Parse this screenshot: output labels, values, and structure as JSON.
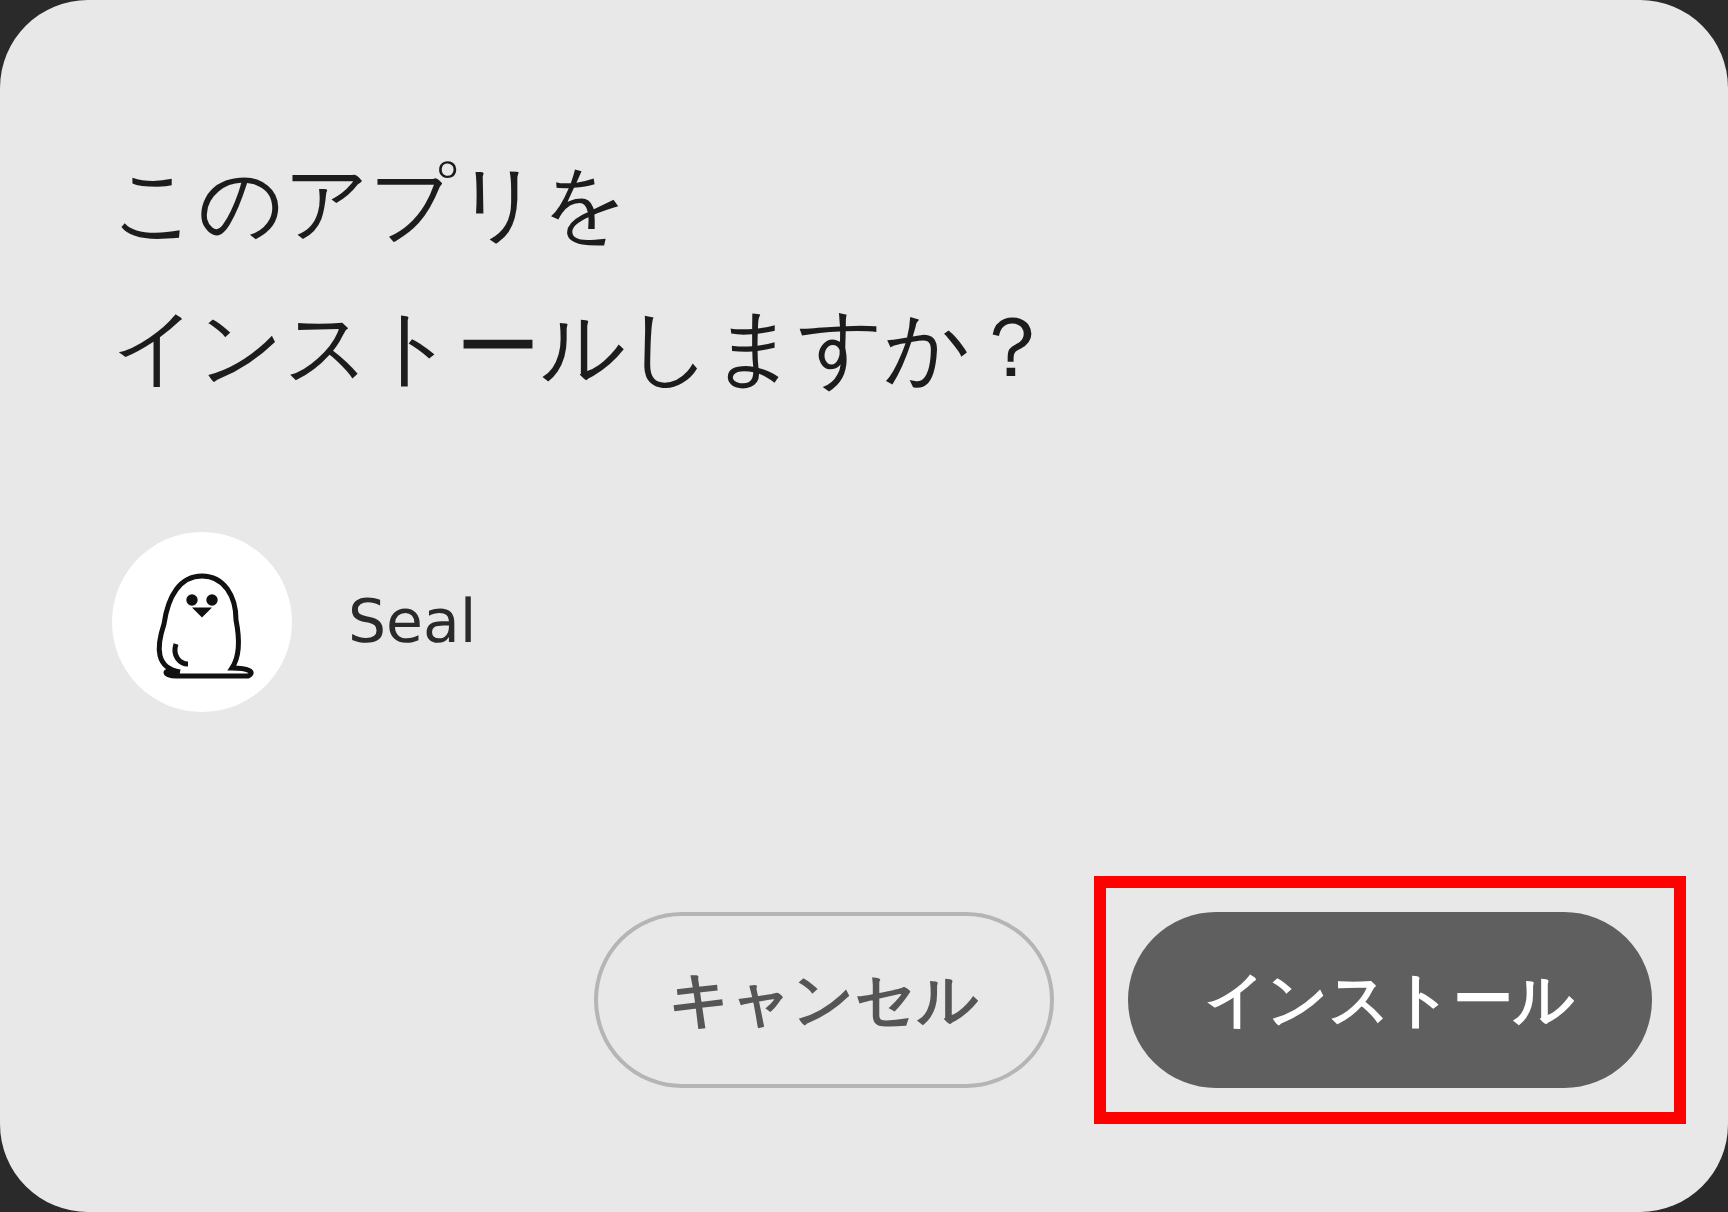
{
  "dialog": {
    "title_lines": [
      "このアプリを",
      "インストールしますか？"
    ],
    "app": {
      "name": "Seal"
    },
    "buttons": [
      {
        "label": "キャンセル",
        "kind": "outlined",
        "highlighted": false
      },
      {
        "label": "インストール",
        "kind": "filled",
        "highlighted": true
      }
    ]
  }
}
